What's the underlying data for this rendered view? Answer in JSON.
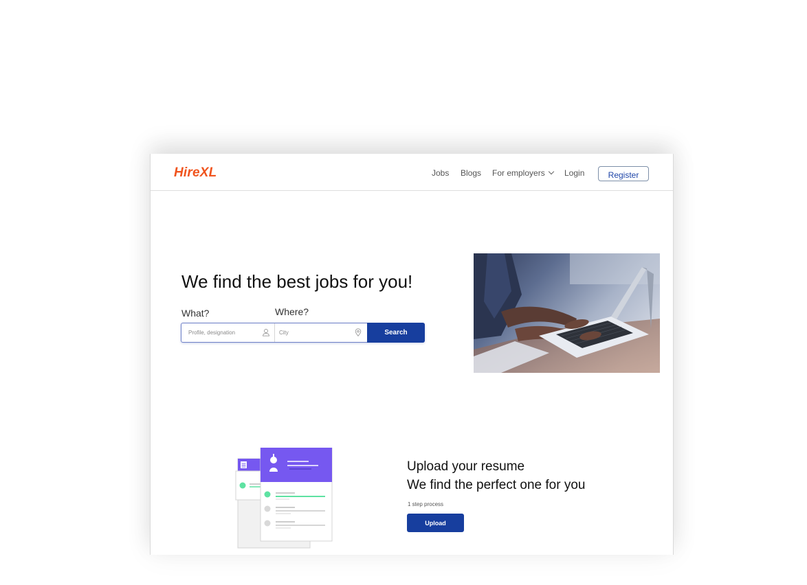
{
  "header": {
    "logo": "HireXL",
    "nav": {
      "jobs": "Jobs",
      "blogs": "Blogs",
      "for_employers": "For employers",
      "login": "Login",
      "register": "Register"
    }
  },
  "hero": {
    "title": "We find the best jobs for you!",
    "what_label": "What?",
    "where_label": "Where?",
    "what_placeholder": "Profile, designation",
    "where_placeholder": "City",
    "search_button": "Search"
  },
  "upload": {
    "line1": "Upload your resume",
    "line2": "We find the perfect one for you",
    "step_text": "1 step process",
    "button": "Upload"
  },
  "colors": {
    "brand": "#f0541e",
    "primary": "#173e9e",
    "accent_purple": "#7658f0",
    "accent_green": "#5ee2a2"
  },
  "icons": [
    "user-icon",
    "location-pin-icon",
    "chevron-down-icon",
    "menu-icon",
    "avatar-icon"
  ]
}
